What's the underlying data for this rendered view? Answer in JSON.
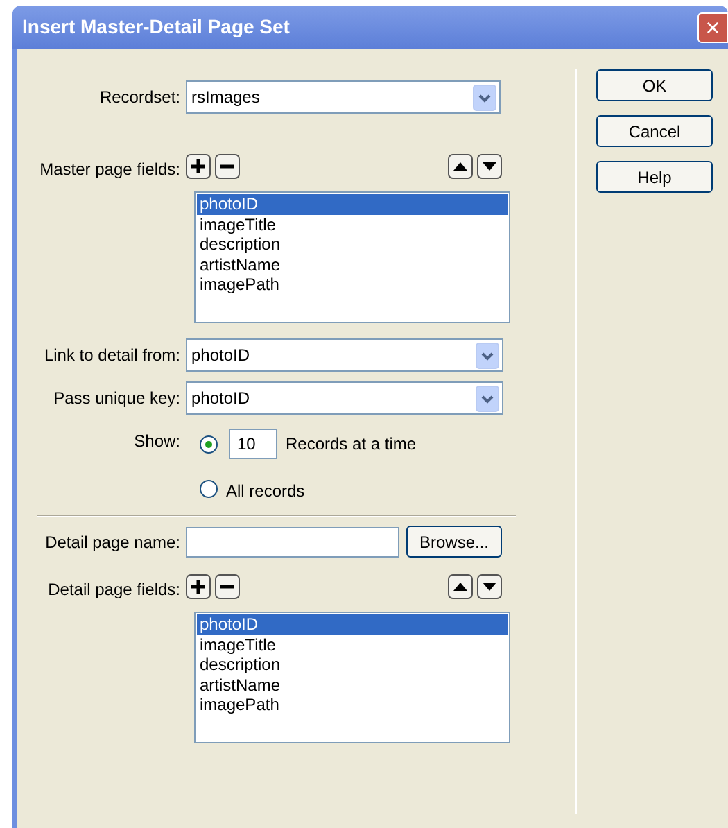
{
  "window": {
    "title": "Insert Master-Detail Page Set",
    "close": "×"
  },
  "recordset": {
    "label": "Recordset:",
    "value": "rsImages"
  },
  "master_fields": {
    "label": "Master page fields:",
    "items": [
      {
        "label": "photoID",
        "selected": true
      },
      {
        "label": "imageTitle",
        "selected": false
      },
      {
        "label": "description",
        "selected": false
      },
      {
        "label": "artistName",
        "selected": false
      },
      {
        "label": "imagePath",
        "selected": false
      }
    ]
  },
  "link_from": {
    "label": "Link to detail from:",
    "value": "photoID"
  },
  "unique_key": {
    "label": "Pass unique key:",
    "value": "photoID"
  },
  "show": {
    "label": "Show:",
    "options": [
      {
        "kind": "count",
        "value": "10",
        "label": "Records at a time",
        "selected": true
      },
      {
        "kind": "all",
        "label": "All records",
        "selected": false
      }
    ]
  },
  "detail_page_name": {
    "label": "Detail page name:",
    "browse": "Browse..."
  },
  "detail_fields": {
    "label": "Detail page fields:",
    "items": [
      {
        "label": "photoID",
        "selected": true
      },
      {
        "label": "imageTitle",
        "selected": false
      },
      {
        "label": "description",
        "selected": false
      },
      {
        "label": "artistName",
        "selected": false
      },
      {
        "label": "imagePath",
        "selected": false
      }
    ]
  },
  "buttons": [
    "OK",
    "Cancel",
    "Help"
  ]
}
